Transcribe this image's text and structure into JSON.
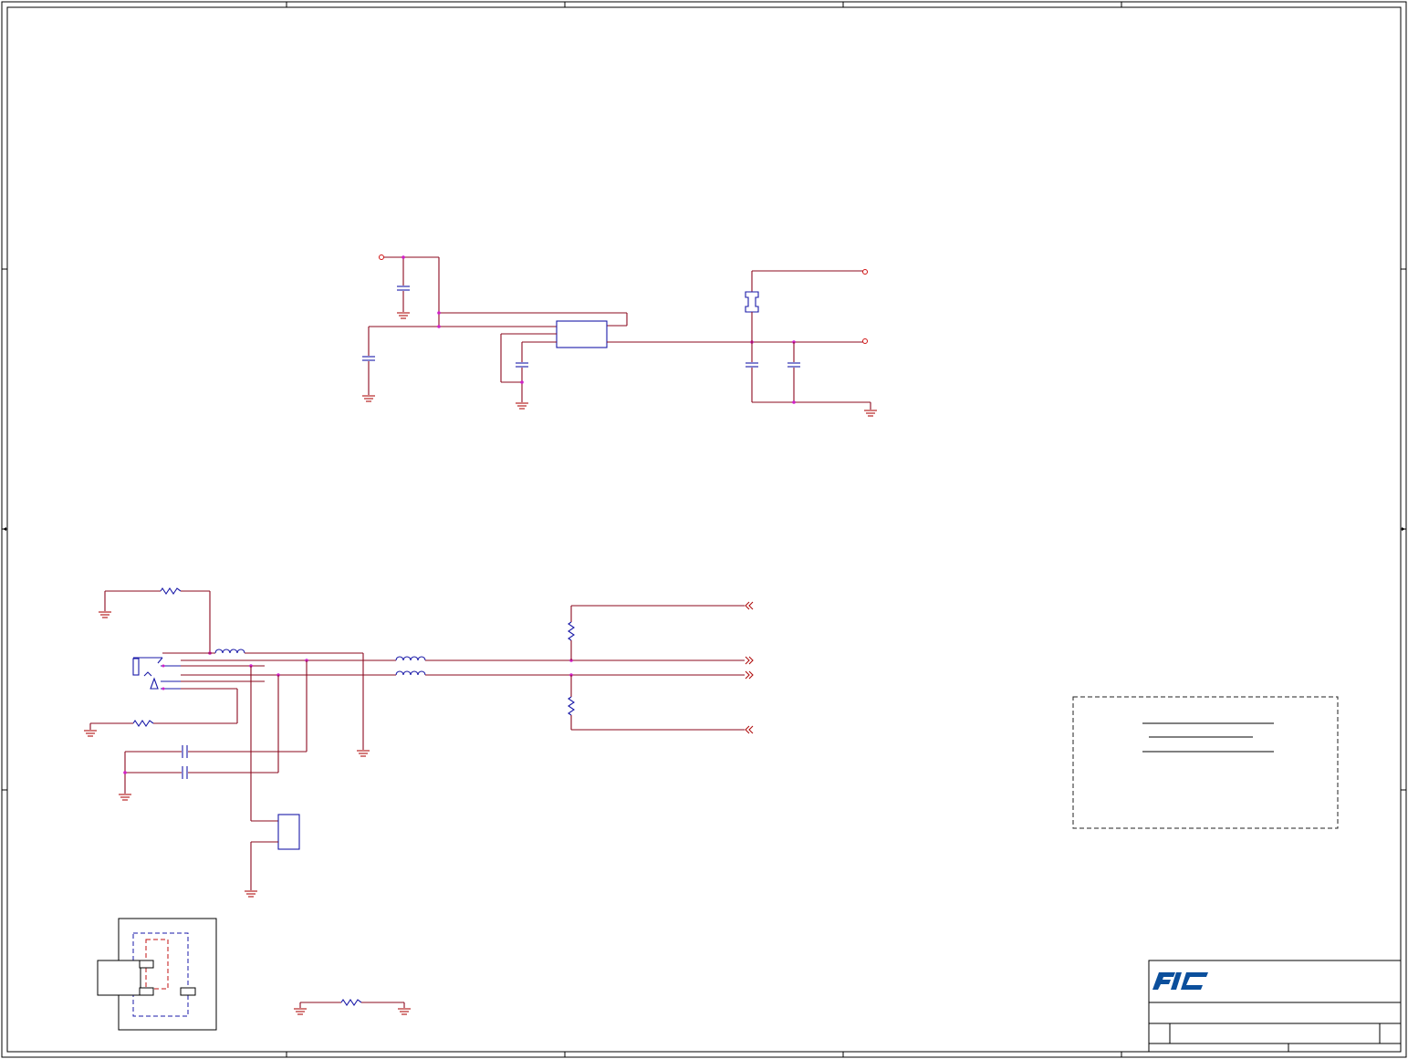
{
  "title_block": {
    "logo_text": "FIC"
  },
  "colors": {
    "wire": "#8b0a1e",
    "component": "#1a1aa8",
    "ground": "#b01010",
    "junction": "#d020c8",
    "logo": "#0b4f9c"
  }
}
